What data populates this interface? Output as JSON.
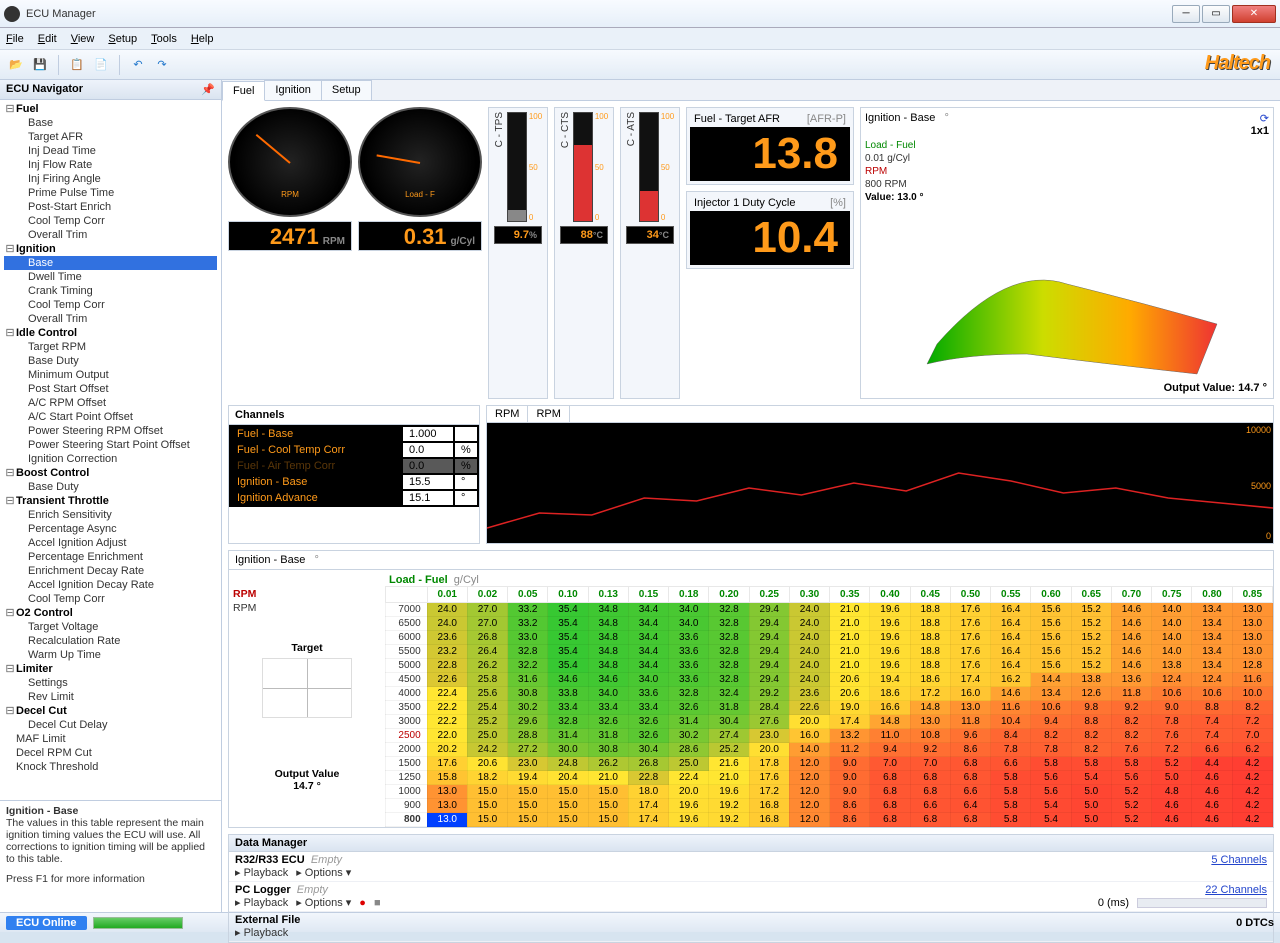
{
  "window": {
    "title": "ECU Manager"
  },
  "menu": [
    "File",
    "Edit",
    "View",
    "Setup",
    "Tools",
    "Help"
  ],
  "brand": "Haltech",
  "nav": {
    "title": "ECU Navigator",
    "groups": [
      {
        "name": "Fuel",
        "items": [
          "Base",
          "Target AFR",
          "Inj Dead Time",
          "Inj Flow Rate",
          "Inj Firing Angle",
          "Prime Pulse Time",
          "Post-Start Enrich",
          "Cool Temp Corr",
          "Overall Trim"
        ]
      },
      {
        "name": "Ignition",
        "items": [
          "Base",
          "Dwell Time",
          "Crank Timing",
          "Cool Temp Corr",
          "Overall Trim"
        ],
        "selected": 0
      },
      {
        "name": "Idle Control",
        "items": [
          "Target RPM",
          "Base Duty",
          "Minimum Output",
          "Post Start Offset",
          "A/C RPM Offset",
          "A/C Start Point Offset",
          "Power Steering RPM Offset",
          "Power Steering Start Point Offset",
          "Ignition Correction"
        ]
      },
      {
        "name": "Boost Control",
        "items": [
          "Base Duty"
        ]
      },
      {
        "name": "Transient Throttle",
        "items": [
          "Enrich Sensitivity",
          "Percentage Async",
          "Accel Ignition Adjust",
          "Percentage Enrichment",
          "Enrichment Decay Rate",
          "Accel Ignition Decay Rate",
          "Cool Temp Corr"
        ]
      },
      {
        "name": "O2 Control",
        "items": [
          "Target Voltage",
          "Recalculation Rate",
          "Warm Up Time"
        ]
      },
      {
        "name": "Limiter",
        "items": [
          "Settings",
          "Rev Limit"
        ]
      },
      {
        "name": "Decel Cut",
        "items": [
          "Decel Cut Delay"
        ]
      }
    ],
    "loose": [
      "MAF Limit",
      "Decel RPM Cut",
      "Knock Threshold"
    ]
  },
  "help": {
    "title": "Ignition - Base",
    "body": "The values in this table represent the main ignition timing values the ECU will use. All corrections to ignition timing will be applied to this table.",
    "footer": "Press F1 for more information"
  },
  "tabs": {
    "items": [
      "Fuel",
      "Ignition",
      "Setup"
    ],
    "active": 0
  },
  "gauges": {
    "rpm": {
      "label": "RPM",
      "scale": "x1000",
      "value": "2471",
      "unit": "RPM",
      "angle": -140
    },
    "load": {
      "label": "Load - F",
      "value": "0.31",
      "unit": "g/Cyl",
      "angle": -170
    }
  },
  "bars": [
    {
      "name": "C - TPS",
      "read": "9.7",
      "unit": "%",
      "pct": 10,
      "color": "#888"
    },
    {
      "name": "C - CTS",
      "read": "88",
      "unit": "°C",
      "pct": 70,
      "color": "#d33"
    },
    {
      "name": "C - ATS",
      "read": "34",
      "unit": "°C",
      "pct": 28,
      "color": "#d33"
    }
  ],
  "bigs": [
    {
      "title": "Fuel - Target AFR",
      "unit": "[AFR-P]",
      "value": "13.8"
    },
    {
      "title": "Injector 1 Duty Cycle",
      "unit": "[%]",
      "value": "10.4"
    }
  ],
  "map3d": {
    "title": "Ignition - Base",
    "unit": "°",
    "dim": "1x1",
    "lines": [
      {
        "lbl": "Load - Fuel",
        "color": "#080"
      },
      {
        "lbl": "0.01 g/Cyl",
        "color": "#333"
      },
      {
        "lbl": "RPM",
        "color": "#b00"
      },
      {
        "lbl": "800 RPM",
        "color": "#333"
      },
      {
        "lbl": "Value: 13.0 °",
        "color": "#000",
        "bold": true
      }
    ],
    "output": "Output Value: 14.7 °"
  },
  "channels": {
    "title": "Channels",
    "rows": [
      {
        "name": "Fuel - Base",
        "val": "1.000",
        "unit": ""
      },
      {
        "name": "Fuel - Cool Temp Corr",
        "val": "0.0",
        "unit": "%"
      },
      {
        "name": "Fuel - Air Temp Corr",
        "val": "0.0",
        "unit": "%",
        "dim": true
      },
      {
        "name": "Ignition - Base",
        "val": "15.5",
        "unit": "°"
      },
      {
        "name": "Ignition Advance",
        "val": "15.1",
        "unit": "°"
      }
    ]
  },
  "graph": {
    "tabs": [
      "RPM",
      "RPM"
    ],
    "active": 0,
    "ylabels": [
      "10000",
      "5000",
      "0"
    ],
    "points": [
      15,
      30,
      28,
      45,
      42,
      55,
      48,
      60,
      52,
      70,
      62,
      50,
      55,
      45,
      40,
      35
    ]
  },
  "table": {
    "title": "Ignition - Base",
    "unit": "°",
    "xlabel": "Load - Fuel",
    "xunit": "g/Cyl",
    "ylabel": "RPM",
    "yunit": "RPM",
    "outlabel": "Output Value",
    "outval": "14.7 °",
    "targetlabel": "Target",
    "cols": [
      "0.01",
      "0.02",
      "0.05",
      "0.10",
      "0.13",
      "0.15",
      "0.18",
      "0.20",
      "0.25",
      "0.30",
      "0.35",
      "0.40",
      "0.45",
      "0.50",
      "0.55",
      "0.60",
      "0.65",
      "0.70",
      "0.75",
      "0.80",
      "0.85"
    ],
    "rows": [
      "7000",
      "6500",
      "6000",
      "5500",
      "5000",
      "4500",
      "4000",
      "3500",
      "3000",
      "2500",
      "2000",
      "1500",
      "1250",
      "1000",
      "900",
      "800"
    ],
    "selrow": 15,
    "selcolrow": "2500",
    "data": [
      [
        24.0,
        27.0,
        33.2,
        35.4,
        34.8,
        34.4,
        34.0,
        32.8,
        29.4,
        24.0,
        21.0,
        19.6,
        18.8,
        17.6,
        16.4,
        15.6,
        15.2,
        14.6,
        14.0,
        13.4,
        13.0
      ],
      [
        24.0,
        27.0,
        33.2,
        35.4,
        34.8,
        34.4,
        34.0,
        32.8,
        29.4,
        24.0,
        21.0,
        19.6,
        18.8,
        17.6,
        16.4,
        15.6,
        15.2,
        14.6,
        14.0,
        13.4,
        13.0
      ],
      [
        23.6,
        26.8,
        33.0,
        35.4,
        34.8,
        34.4,
        33.6,
        32.8,
        29.4,
        24.0,
        21.0,
        19.6,
        18.8,
        17.6,
        16.4,
        15.6,
        15.2,
        14.6,
        14.0,
        13.4,
        13.0
      ],
      [
        23.2,
        26.4,
        32.8,
        35.4,
        34.8,
        34.4,
        33.6,
        32.8,
        29.4,
        24.0,
        21.0,
        19.6,
        18.8,
        17.6,
        16.4,
        15.6,
        15.2,
        14.6,
        14.0,
        13.4,
        13.0
      ],
      [
        22.8,
        26.2,
        32.2,
        35.4,
        34.8,
        34.4,
        33.6,
        32.8,
        29.4,
        24.0,
        21.0,
        19.6,
        18.8,
        17.6,
        16.4,
        15.6,
        15.2,
        14.6,
        13.8,
        13.4,
        12.8
      ],
      [
        22.6,
        25.8,
        31.6,
        34.6,
        34.6,
        34.0,
        33.6,
        32.8,
        29.4,
        24.0,
        20.6,
        19.4,
        18.6,
        17.4,
        16.2,
        14.4,
        13.8,
        13.6,
        12.4,
        12.4,
        11.6
      ],
      [
        22.4,
        25.6,
        30.8,
        33.8,
        34.0,
        33.6,
        32.8,
        32.4,
        29.2,
        23.6,
        20.6,
        18.6,
        17.2,
        16.0,
        14.6,
        13.4,
        12.6,
        11.8,
        10.6,
        10.6,
        10.0
      ],
      [
        22.2,
        25.4,
        30.2,
        33.4,
        33.4,
        33.4,
        32.6,
        31.8,
        28.4,
        22.6,
        19.0,
        16.6,
        14.8,
        13.0,
        11.6,
        10.6,
        9.8,
        9.2,
        9.0,
        8.8,
        8.2
      ],
      [
        22.2,
        25.2,
        29.6,
        32.8,
        32.6,
        32.6,
        31.4,
        30.4,
        27.6,
        20.0,
        17.4,
        14.8,
        13.0,
        11.8,
        10.4,
        9.4,
        8.8,
        8.2,
        7.8,
        7.4,
        7.2
      ],
      [
        22.0,
        25.0,
        28.8,
        31.4,
        31.8,
        32.6,
        30.2,
        27.4,
        23.0,
        16.0,
        13.2,
        11.0,
        10.8,
        9.6,
        8.4,
        8.2,
        8.2,
        8.2,
        7.6,
        7.4,
        7.0
      ],
      [
        20.2,
        24.2,
        27.2,
        30.0,
        30.8,
        30.4,
        28.6,
        25.2,
        20.0,
        14.0,
        11.2,
        9.4,
        9.2,
        8.6,
        7.8,
        7.8,
        8.2,
        7.6,
        7.2,
        6.6,
        6.2
      ],
      [
        17.6,
        20.6,
        23.0,
        24.8,
        26.2,
        26.8,
        25.0,
        21.6,
        17.8,
        12.0,
        9.0,
        7.0,
        7.0,
        6.8,
        6.6,
        5.8,
        5.8,
        5.8,
        5.2,
        4.4,
        4.2
      ],
      [
        15.8,
        18.2,
        19.4,
        20.4,
        21.0,
        22.8,
        22.4,
        21.0,
        17.6,
        12.0,
        9.0,
        6.8,
        6.8,
        6.8,
        5.8,
        5.6,
        5.4,
        5.6,
        5.0,
        4.6,
        4.2
      ],
      [
        13.0,
        15.0,
        15.0,
        15.0,
        15.0,
        18.0,
        20.0,
        19.6,
        17.2,
        12.0,
        9.0,
        6.8,
        6.8,
        6.6,
        5.8,
        5.6,
        5.0,
        5.2,
        4.8,
        4.6,
        4.2
      ],
      [
        13.0,
        15.0,
        15.0,
        15.0,
        15.0,
        17.4,
        19.6,
        19.2,
        16.8,
        12.0,
        8.6,
        6.8,
        6.6,
        6.4,
        5.8,
        5.4,
        5.0,
        5.2,
        4.6,
        4.6,
        4.2
      ],
      [
        13.0,
        15.0,
        15.0,
        15.0,
        15.0,
        17.4,
        19.6,
        19.2,
        16.8,
        12.0,
        8.6,
        6.8,
        6.8,
        6.8,
        5.8,
        5.4,
        5.0,
        5.2,
        4.6,
        4.6,
        4.2
      ]
    ]
  },
  "dmgr": {
    "title": "Data Manager",
    "sources": [
      {
        "name": "R32/R33 ECU",
        "status": "Empty",
        "channels": "5 Channels",
        "controls": [
          "Playback",
          "Options ▾"
        ]
      },
      {
        "name": "PC Logger",
        "status": "Empty",
        "channels": "22 Channels",
        "controls": [
          "Playback",
          "Options ▾"
        ],
        "rec": true,
        "ms": "0  (ms)"
      },
      {
        "name": "External File",
        "status": "",
        "channels": "",
        "controls": [
          "Playback"
        ]
      }
    ]
  },
  "status": {
    "online": "ECU Online",
    "dtc": "0 DTCs"
  }
}
